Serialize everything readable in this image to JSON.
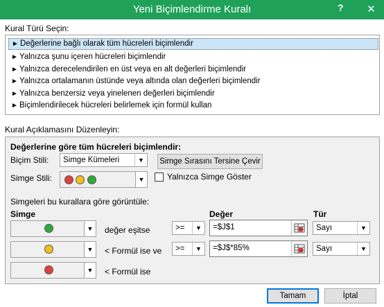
{
  "window": {
    "title": "Yeni Biçimlendirme Kuralı",
    "help_label": "?",
    "close_label": "✕"
  },
  "rule_type": {
    "heading": "Kural Türü Seçin:",
    "items": [
      "Değerlerine bağlı olarak tüm hücreleri biçimlendir",
      "Yalnızca şunu içeren hücreleri biçimlendir",
      "Yalnızca derecelendirilen en üst veya en alt değerleri biçimlendir",
      "Yalnızca ortalamanın üstünde veya altında olan değerleri biçimlendir",
      "Yalnızca benzersiz veya yinelenen değerleri biçimlendir",
      "Biçimlendirilecek hücreleri belirlemek için formül kullan"
    ],
    "selected_index": 0
  },
  "description": {
    "heading": "Kural Açıklamasını Düzenleyin:",
    "section_title": "Değerlerine göre tüm hücreleri biçimlendir:",
    "format_style_label": "Biçim Stili:",
    "format_style_value": "Simge Kümeleri",
    "reverse_button": "Simge Sırasını Tersine Çevir",
    "icon_style_label": "Simge Stili:",
    "icon_style_colors": [
      "#e04040",
      "#f2c020",
      "#2faa3a"
    ],
    "show_icon_only_label": "Yalnızca Simge Göster",
    "show_icon_only_checked": false,
    "rules_intro": "Simgeleri bu kurallara göre görüntüle:",
    "col_icon": "Simge",
    "col_value": "Değer",
    "col_type": "Tür",
    "rows": [
      {
        "icon_color": "#2faa3a",
        "condition": "değer eşitse",
        "operator": ">=",
        "value": "=$J$1",
        "type": "Sayı"
      },
      {
        "icon_color": "#f2c020",
        "condition": "< Formül ise ve",
        "operator": ">=",
        "value": "=$J$*85%",
        "type": "Sayı"
      },
      {
        "icon_color": "#e04040",
        "condition": "< Formül ise"
      }
    ]
  },
  "buttons": {
    "ok": "Tamam",
    "cancel": "İptal"
  }
}
